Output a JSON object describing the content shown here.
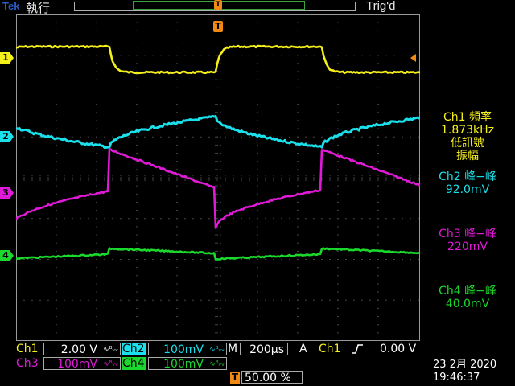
{
  "header": {
    "brand": "Tek",
    "run_status": "執行",
    "trigger_status": "Trig'd",
    "trigger_position_marker": "T"
  },
  "channels": [
    {
      "id": "ch1",
      "marker": "1",
      "color": "#f6f01a",
      "scale_label": "Ch1",
      "scale": "2.00 V"
    },
    {
      "id": "ch2",
      "marker": "2",
      "color": "#19e0ea",
      "scale_label": "Ch2",
      "scale": "100mV"
    },
    {
      "id": "ch3",
      "marker": "3",
      "color": "#e01ad8",
      "scale_label": "Ch3",
      "scale": "100mV"
    },
    {
      "id": "ch4",
      "marker": "4",
      "color": "#1ad82c",
      "scale_label": "Ch4",
      "scale": "100mV"
    }
  ],
  "bandwidth_symbol": "∿ᴮᵥᵥ",
  "measurements": {
    "m1": {
      "title": "Ch1 頻率",
      "value": "1.873kHz",
      "note1": "低訊號",
      "note2": "振幅"
    },
    "m2": {
      "title": "Ch2 峰−峰",
      "value": "92.0mV"
    },
    "m3": {
      "title": "Ch3 峰−峰",
      "value": "220mV"
    },
    "m4": {
      "title": "Ch4 峰−峰",
      "value": "40.0mV"
    }
  },
  "timebase": {
    "label": "M",
    "value": "200µs"
  },
  "trigger": {
    "mode": "A",
    "source": "Ch1",
    "slope_icon": "rising-edge-icon",
    "level": "0.00 V",
    "position_marker": "T",
    "position": "50.00 %"
  },
  "datetime": {
    "date": "23 2月  2020",
    "time": "19:46:37"
  },
  "colors": {
    "accent_orange": "#f08a14",
    "grid": "#9a9a9a"
  }
}
